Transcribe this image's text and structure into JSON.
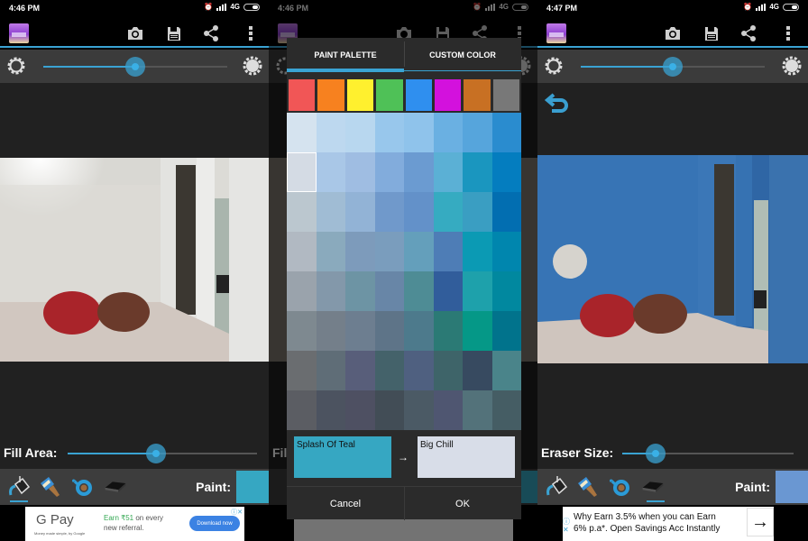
{
  "colors": {
    "accent": "#3aa3d3",
    "toolbar_bg": "#3d3d3d",
    "workspace_bg": "#212121"
  },
  "screens": [
    {
      "status": {
        "time": "4:46 PM",
        "network": "4G"
      },
      "actionbar": {
        "icons": [
          "app-logo",
          "camera-icon",
          "save-icon",
          "share-icon",
          "overflow-menu-icon"
        ]
      },
      "brightness": {
        "value_pct": 55
      },
      "size_slider": {
        "label": "Fill Area:",
        "value_pct": 47
      },
      "tools": [
        "fill-bucket",
        "paint-brush",
        "lasso",
        "eraser"
      ],
      "active_tool": "fill-bucket",
      "paint": {
        "label": "Paint:",
        "color": "#36a7c2"
      },
      "ad": {
        "brand": "G Pay",
        "tagline": "Money made simple, by Google",
        "text_line1_prefix": "Earn ₹51",
        "text_line1_suffix": " on every",
        "text_line2": "new referral.",
        "button": "Download now"
      }
    },
    {
      "status": {
        "time": "4:46 PM",
        "network": "4G"
      },
      "size_slider": {
        "label": "Fill Area:"
      },
      "dialog": {
        "tabs": [
          {
            "label": "PAINT PALETTE",
            "active": true
          },
          {
            "label": "CUSTOM COLOR",
            "active": false
          }
        ],
        "basic_colors": [
          "#f15656",
          "#f7811f",
          "#fff02e",
          "#4fc157",
          "#2f8fef",
          "#d311dd",
          "#c87023",
          "#787878"
        ],
        "palette": [
          [
            "#d5e3ef",
            "#bdd8ef",
            "#b8d7ef",
            "#98c7ec",
            "#8fc3eb",
            "#6ab0e2",
            "#56a5dc",
            "#2a8ccf"
          ],
          [
            "#d4dbe4",
            "#a9c7e7",
            "#9fbde2",
            "#82acdc",
            "#6b9bd1",
            "#5bb0d5",
            "#1a96bf",
            "#047dbf"
          ],
          [
            "#bbc7cf",
            "#a0bcd4",
            "#92b3d6",
            "#7099cb",
            "#6391c9",
            "#36abc1",
            "#3a9ec2",
            "#026eb1"
          ],
          [
            "#b1b9c2",
            "#8aaabd",
            "#7d9bbb",
            "#7a9dbd",
            "#649fbb",
            "#4e7db6",
            "#0b9ab4",
            "#0086ae"
          ],
          [
            "#9aa3ac",
            "#8398aa",
            "#6d94a4",
            "#6886a7",
            "#4e8c95",
            "#315d9b",
            "#1ea1ab",
            "#01889f"
          ],
          [
            "#7e8990",
            "#747f8a",
            "#6d7e90",
            "#5e7488",
            "#4d7a8c",
            "#2b7a75",
            "#059887",
            "#01738c"
          ],
          [
            "#6a6d70",
            "#5f6d77",
            "#585e7a",
            "#44626a",
            "#4f6080",
            "#3e6469",
            "#374a60",
            "#4a848a"
          ],
          [
            "#5b5d63",
            "#4c5360",
            "#4e5062",
            "#424d56",
            "#4b5a65",
            "#4f5671",
            "#53727a",
            "#455d64"
          ]
        ],
        "selected_cell": [
          1,
          0
        ],
        "current_color": {
          "name": "Splash Of Teal",
          "hex": "#36a7c2"
        },
        "new_color": {
          "name": "Big Chill",
          "hex": "#d8dde8"
        },
        "arrow": "→",
        "cancel_label": "Cancel",
        "ok_label": "OK"
      }
    },
    {
      "status": {
        "time": "4:47 PM",
        "network": "4G"
      },
      "brightness": {
        "value_pct": 55
      },
      "undo": "undo-icon",
      "size_slider": {
        "label": "Eraser Size:",
        "value_pct": 17
      },
      "tools": [
        "fill-bucket",
        "paint-brush",
        "lasso",
        "eraser"
      ],
      "active_tool": "eraser",
      "paint": {
        "label": "Paint:",
        "color": "#6a97d2"
      },
      "ad": {
        "text_line1": "Why Earn 3.5% when you can Earn",
        "text_line2": "6% p.a*. Open Savings Acc Instantly",
        "arrow": "→"
      }
    }
  ]
}
